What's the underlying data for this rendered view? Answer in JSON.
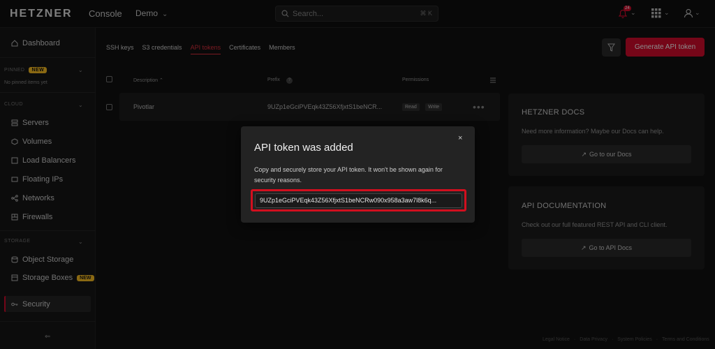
{
  "topbar": {
    "logo": "HETZNER",
    "logo_sub": "Console",
    "project": "Demo",
    "search_placeholder": "Search...",
    "search_shortcut": "⌘ K",
    "notification_count": "24"
  },
  "sidebar": {
    "dashboard": "Dashboard",
    "pinned_label": "PINNED",
    "pinned_badge": "NEW",
    "pinned_empty": "No pinned items yet",
    "cloud_label": "CLOUD",
    "cloud_items": [
      "Servers",
      "Volumes",
      "Load Balancers",
      "Floating IPs",
      "Networks",
      "Firewalls"
    ],
    "storage_label": "STORAGE",
    "storage_items": [
      "Object Storage",
      "Storage Boxes"
    ],
    "storage_box_badge": "NEW",
    "security": "Security",
    "collapse": "⇐"
  },
  "tabs": [
    "SSH keys",
    "S3 credentials",
    "API tokens",
    "Certificates",
    "Members"
  ],
  "generate_button": "Generate API token",
  "table": {
    "headers": {
      "description": "Description ⌃",
      "prefix": "Prefix",
      "prefix_help": "?",
      "permissions": "Permissions"
    },
    "row": {
      "description": "Pivotlar",
      "prefix": "9UZp1eGciPVEqk43Z56XfjxtS1beNCR...",
      "perm_read": "Read",
      "perm_write": "Write"
    }
  },
  "docs_card": {
    "title": "HETZNER DOCS",
    "text": "Need more information? Maybe our Docs can help.",
    "button": "Go to our Docs"
  },
  "api_card": {
    "title": "API DOCUMENTATION",
    "text": "Check out our full featured REST API and CLI client.",
    "button": "Go to API Docs"
  },
  "footer": [
    "Legal Notice",
    "Data Privacy",
    "System Policies",
    "Terms and Conditions"
  ],
  "modal": {
    "title": "API token was added",
    "text": "Copy and securely store your API token. It won't be shown again for security reasons.",
    "token": "9UZp1eGciPVEqk43Z56XfjxtS1beNCRw090x958a3aw7l8k6q...",
    "close": "×"
  },
  "colors": {
    "accent": "#d50c2d",
    "highlight": "#d20f1e"
  }
}
